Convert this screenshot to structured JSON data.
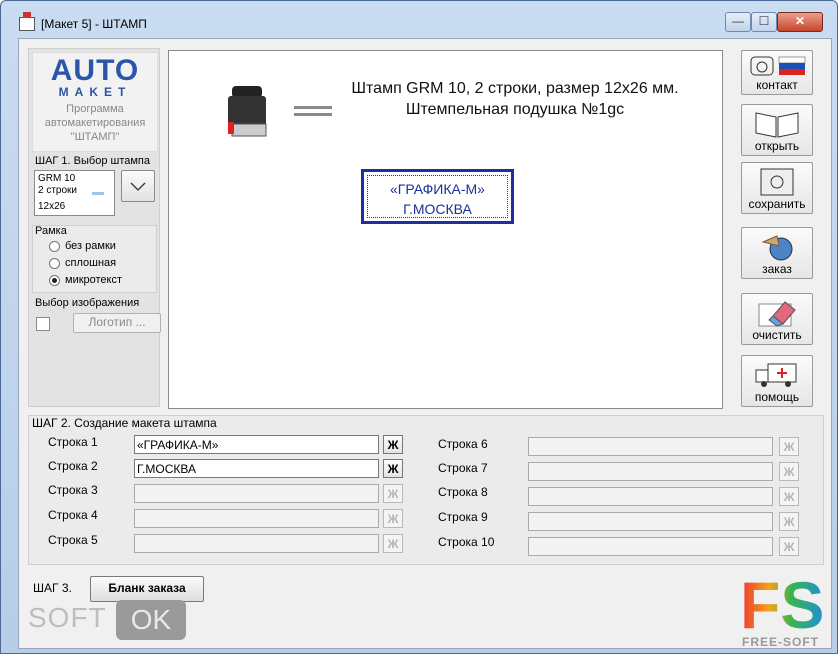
{
  "window": {
    "title": "[Макет 5] - ШТАМП"
  },
  "titlebar": {
    "minimize_glyph": "—",
    "maximize_glyph": "☐",
    "close_glyph": "✕"
  },
  "logo": {
    "auto": "AUTO",
    "maket": "MAKET",
    "sub1": "Программа",
    "sub2": "автомакетирования",
    "sub3": "\"ШТАМП\""
  },
  "step1": {
    "label": "ШАГ 1. Выбор штампа",
    "stamp_lines": [
      "GRM 10",
      "2 строки",
      "12x26"
    ]
  },
  "frame": {
    "label": "Рамка",
    "options": [
      "без рамки",
      "сплошная",
      "микротекст"
    ],
    "selected": "микротекст"
  },
  "image": {
    "label": "Выбор изображения",
    "button": "Логотип ..."
  },
  "preview": {
    "description": "Штамп GRM 10, 2 строки, размер 12x26 мм. Штемпельная подушка №1gc",
    "stamp_line1": "«ГРАФИКА-М»",
    "stamp_line2": "Г.МОСКВА",
    "stamp_color": "#1c2f9a"
  },
  "actions": [
    {
      "label": "контакт",
      "icon": "phone-icon"
    },
    {
      "label": "открыть",
      "icon": "book-icon"
    },
    {
      "label": "сохранить",
      "icon": "safe-icon"
    },
    {
      "label": "заказ",
      "icon": "globe-icon"
    },
    {
      "label": "очистить",
      "icon": "eraser-icon"
    },
    {
      "label": "помощь",
      "icon": "ambulance-icon"
    }
  ],
  "step2": {
    "label": "ШАГ 2. Создание макета штампа",
    "bold_label": "Ж",
    "rows_left": [
      {
        "label": "Строка 1",
        "value": "«ГРАФИКА-М»"
      },
      {
        "label": "Строка 2",
        "value": "Г.МОСКВА"
      },
      {
        "label": "Строка 3",
        "value": ""
      },
      {
        "label": "Строка 4",
        "value": ""
      },
      {
        "label": "Строка 5",
        "value": ""
      }
    ],
    "rows_right": [
      {
        "label": "Строка 6",
        "value": ""
      },
      {
        "label": "Строка 7",
        "value": ""
      },
      {
        "label": "Строка 8",
        "value": ""
      },
      {
        "label": "Строка 9",
        "value": ""
      },
      {
        "label": "Строка 10",
        "value": ""
      }
    ]
  },
  "step3": {
    "label": "ШАГ 3.",
    "button": "Бланк заказа"
  },
  "watermark": {
    "soft": "SOFT",
    "ok": "OK",
    "fs": "FS",
    "fs_sub": "FREE-SOFT"
  }
}
